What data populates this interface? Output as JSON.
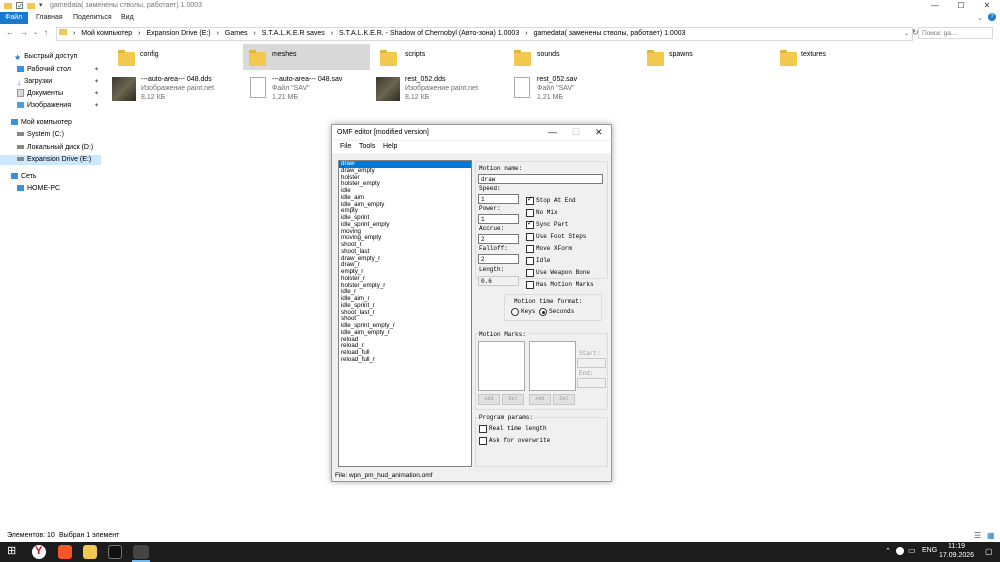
{
  "explorer": {
    "title": "gamedata( заменены стволы, работает) 1.0003",
    "window_buttons": {
      "minimize": "—",
      "maximize": "☐",
      "close": "✕"
    },
    "ribbon_tabs": [
      "Файл",
      "Главная",
      "Поделиться",
      "Вид"
    ],
    "address": {
      "segments": [
        "Мой компьютер",
        "Expansion Drive (E:)",
        "Games",
        "S.T.A.L.K.E.R saves",
        "S.T.A.L.K.E.R. - Shadow of Chernobyl (Авто-зона) 1.0003",
        "gamedata( заменены стволы, работает) 1.0003"
      ],
      "separator": "›"
    },
    "search_placeholder": "Поиск: ga...",
    "nav": [
      {
        "label": "Быстрый доступ",
        "pinned": false
      },
      {
        "label": "Рабочий стол",
        "pinned": true
      },
      {
        "label": "Загрузки",
        "pinned": true
      },
      {
        "label": "Документы",
        "pinned": true
      },
      {
        "label": "Изображения",
        "pinned": true
      },
      {
        "label": "Мой компьютер",
        "pinned": false
      },
      {
        "label": "System (C:)",
        "pinned": false
      },
      {
        "label": "Локальный диск (D:)",
        "pinned": false
      },
      {
        "label": "Expansion Drive (E:)",
        "pinned": false
      },
      {
        "label": "Сеть",
        "pinned": false
      },
      {
        "label": "HOME-PC",
        "pinned": false
      }
    ],
    "folders": [
      "config",
      "meshes",
      "scripts",
      "sounds",
      "spawns",
      "textures"
    ],
    "files": [
      {
        "name": "---auto-area--- 048.dds",
        "type": "Изображение paint.net",
        "size": "8,12 КБ"
      },
      {
        "name": "---auto-area--- 048.sav",
        "type": "Файл \"SAV\"",
        "size": "1,21 МБ"
      },
      {
        "name": "rest_052.dds",
        "type": "Изображение paint.net",
        "size": "8,12 КБ"
      },
      {
        "name": "rest_052.sav",
        "type": "Файл \"SAV\"",
        "size": "1,21 МБ"
      }
    ],
    "status": {
      "count": "Элементов: 10",
      "selected": "Выбран 1 элемент"
    }
  },
  "omf": {
    "title": "OMF editor [modified version]",
    "menu": [
      "File",
      "Tools",
      "Help"
    ],
    "animations": [
      "draw",
      "draw_empty",
      "holster",
      "holster_empty",
      "idle",
      "idle_aim",
      "idle_aim_empty",
      "empty",
      "idle_sprint",
      "idle_sprint_empty",
      "moving",
      "moving_empty",
      "shoot_r",
      "shoot_last",
      "draw_empty_r",
      "draw_r",
      "empty_r",
      "holster_r",
      "holster_empty_r",
      "idle_r",
      "idle_aim_r",
      "idle_sprint_r",
      "shoot_last_r",
      "shoot",
      "idle_sprint_empty_r",
      "idle_aim_empty_r",
      "reload",
      "reload_r",
      "reload_full",
      "reload_full_r"
    ],
    "selected_animation": "draw",
    "labels": {
      "motion_name": "Motion name:",
      "speed": "Speed:",
      "power": "Power:",
      "accrue": "Accrue:",
      "falloff": "Falloff:",
      "length": "Length:",
      "time_format": "Motion time format:",
      "motion_marks": "Motion Marks:",
      "start": "Start:",
      "end": "End:",
      "program_params": "Program params:"
    },
    "values": {
      "motion_name": "draw",
      "speed": "1",
      "power": "1",
      "accrue": "2",
      "falloff": "2",
      "length": "0.6"
    },
    "flags": [
      {
        "label": "Stop At End",
        "checked": true
      },
      {
        "label": "No Mix",
        "checked": false
      },
      {
        "label": "Sync Part",
        "checked": true
      },
      {
        "label": "Use Foot Steps",
        "checked": false
      },
      {
        "label": "Move XForm",
        "checked": false
      },
      {
        "label": "Idle",
        "checked": false
      },
      {
        "label": "Use Weapon Bone",
        "checked": false
      },
      {
        "label": "Has Motion Marks",
        "checked": false
      }
    ],
    "time_format": {
      "options": [
        "Keys",
        "Seconds"
      ],
      "selected": "Seconds"
    },
    "mark_buttons": {
      "add": "Add",
      "del": "Del"
    },
    "program_params": [
      {
        "label": "Real time length",
        "checked": false
      },
      {
        "label": "Ask for overwrite",
        "checked": false
      }
    ],
    "file_label": "File:",
    "file_name": "wpn_pm_hud_animation.omf"
  },
  "taskbar": {
    "lang": "ENG",
    "time": "11:19",
    "date": "17.09.2026",
    "tray_arrow": "⌃"
  },
  "colors": {
    "accent": "#1979ca",
    "selection": "#0078d7",
    "folder": "#f1c94f",
    "taskbar": "#1c1c1c"
  }
}
